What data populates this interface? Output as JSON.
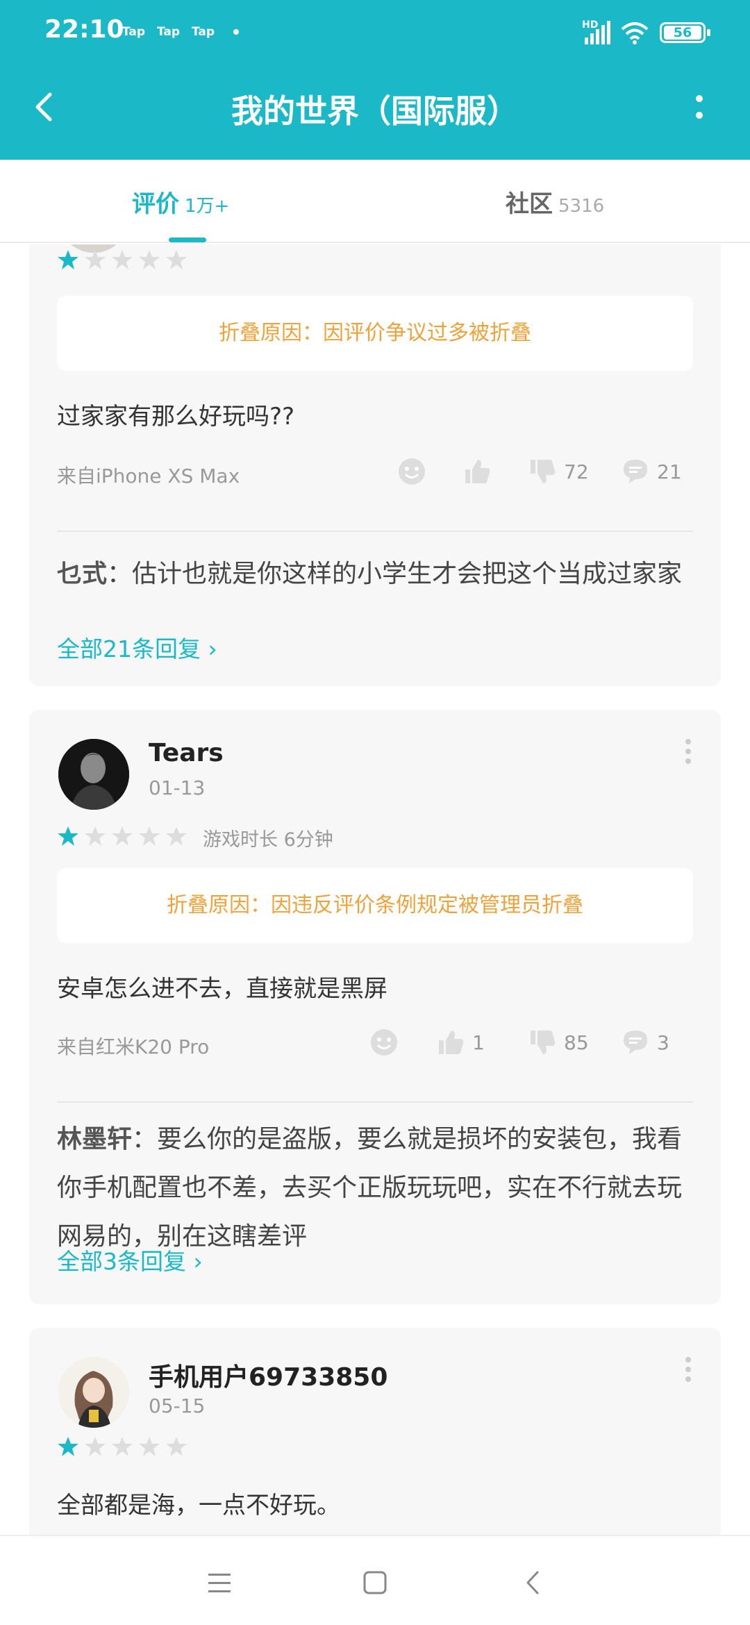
{
  "status_bar": {
    "time": "22:10",
    "tap_labels": [
      "Tap",
      "Tap",
      "Tap"
    ],
    "network": "HD",
    "battery": "56"
  },
  "header": {
    "title": "我的世界（国际服）"
  },
  "tabs": [
    {
      "label": "评价",
      "count": "1万+"
    },
    {
      "label": "社区",
      "count": "5316"
    }
  ],
  "reviews": [
    {
      "rating": 1,
      "fold_notice": "折叠原因：因评价争议过多被折叠",
      "text": "过家家有那么好玩吗??",
      "device": "来自iPhone XS Max",
      "likes": "",
      "dislikes": "72",
      "comments": "21",
      "top_reply": {
        "author": "乜式",
        "separator": "：",
        "text": "估计也就是你这样的小学生才会把这个当成过家家"
      },
      "all_replies": "全部21条回复"
    },
    {
      "username": "Tears",
      "date": "01-13",
      "rating": 1,
      "playtime": "游戏时长 6分钟",
      "fold_notice": "折叠原因：因违反评价条例规定被管理员折叠",
      "text": "安卓怎么进不去，直接就是黑屏",
      "device": "来自红米K20 Pro",
      "likes": "1",
      "dislikes": "85",
      "comments": "3",
      "top_reply": {
        "author": "林墨轩",
        "separator": "：",
        "text": "要么你的是盗版，要么就是损坏的安装包，我看你手机配置也不差，去买个正版玩玩吧，实在不行就去玩网易的，别在这瞎差评"
      },
      "all_replies": "全部3条回复"
    },
    {
      "username": "手机用户69733850",
      "date": "05-15",
      "rating": 1,
      "text": "全部都是海，一点不好玩。"
    }
  ],
  "colors": {
    "accent": "#1bb8c8",
    "notice": "#f0a23a",
    "star_off": "#dddddd"
  }
}
